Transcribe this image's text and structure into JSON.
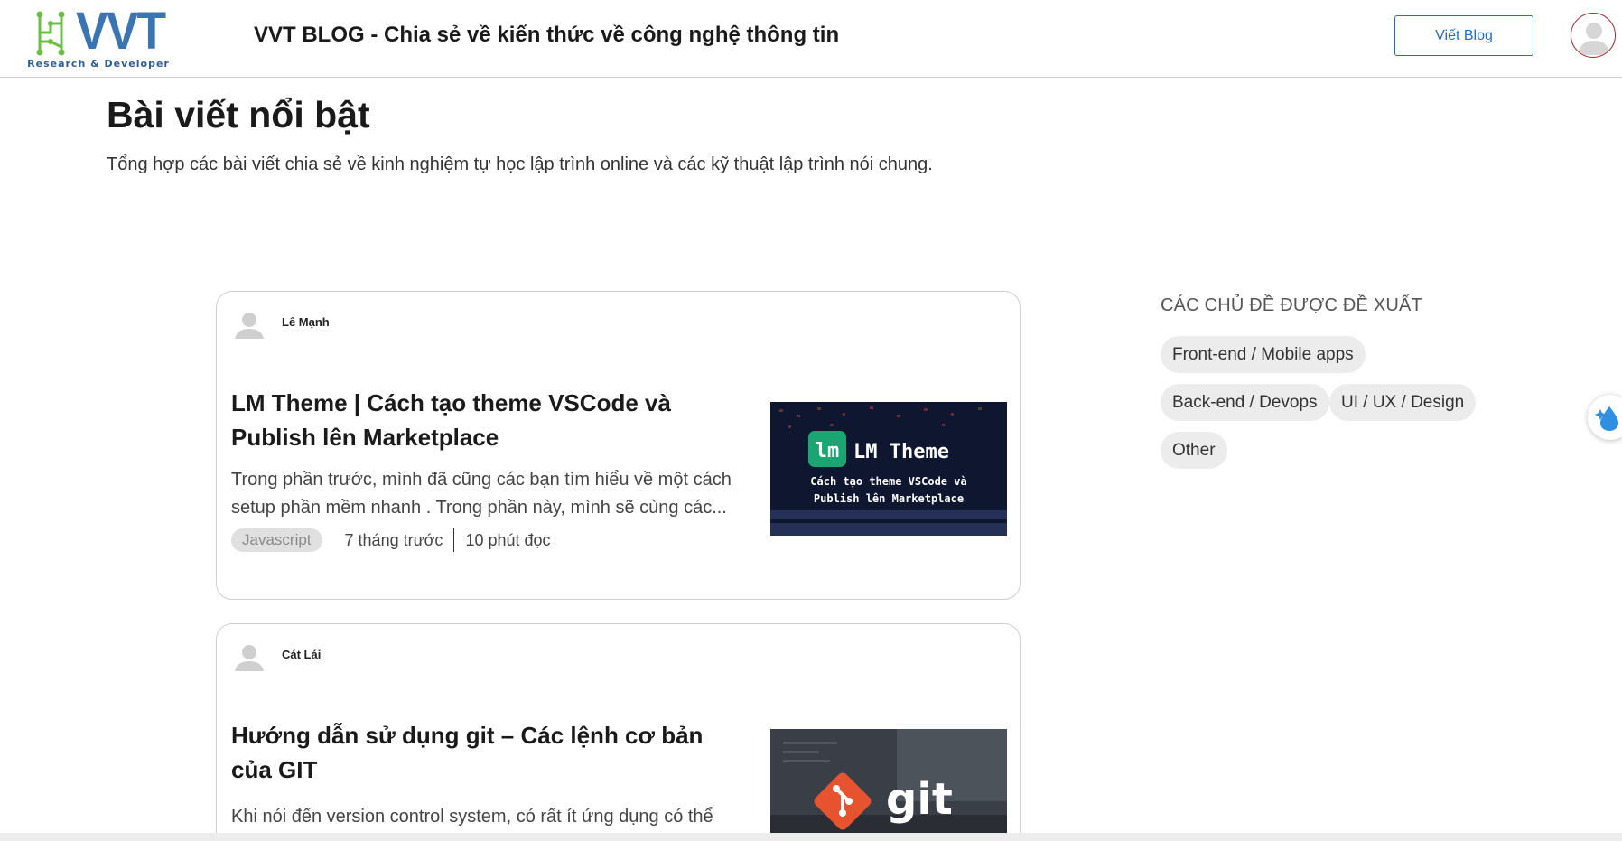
{
  "header": {
    "logo_text": "VVT",
    "logo_subtitle": "Research & Developer",
    "site_title": "VVT BLOG - Chia sẻ về kiến thức về công nghệ thông tin",
    "write_button": "Viết Blog",
    "brand_color": "#3a74b3"
  },
  "main": {
    "title": "Bài viết nổi bật",
    "description": "Tổng hợp các bài viết chia sẻ về kinh nghiệm tự học lập trình online và các kỹ thuật lập trình nói chung."
  },
  "posts": [
    {
      "author": "Lê Mạnh",
      "title": "LM Theme | Cách tạo theme VSCode và Publish lên Marketplace",
      "excerpt": "Trong phần trước, mình đã cũng các bạn tìm hiểu về một cách setup phần mềm nhanh . Trong phần này, mình sẽ cùng các...",
      "tag": "Javascript",
      "time": "7 tháng trước",
      "read": "10 phút đọc",
      "thumb": {
        "badge": "lm",
        "heading": "LM Theme",
        "line1": "Cách tạo theme VSCode và",
        "line2": "Publish lên Marketplace"
      }
    },
    {
      "author": "Cát Lái",
      "title": "Hướng dẫn sử dụng git – Các lệnh cơ bản của GIT",
      "excerpt": "Khi nói đến version control system, có rất ít ứng dụng có thể",
      "thumb": {
        "word": "git"
      }
    }
  ],
  "sidebar": {
    "heading": "CÁC CHỦ ĐỀ ĐƯỢC ĐỀ XUẤT",
    "topics": [
      "Front-end / Mobile apps",
      "Back-end / Devops",
      "UI / UX / Design",
      "Other"
    ]
  }
}
